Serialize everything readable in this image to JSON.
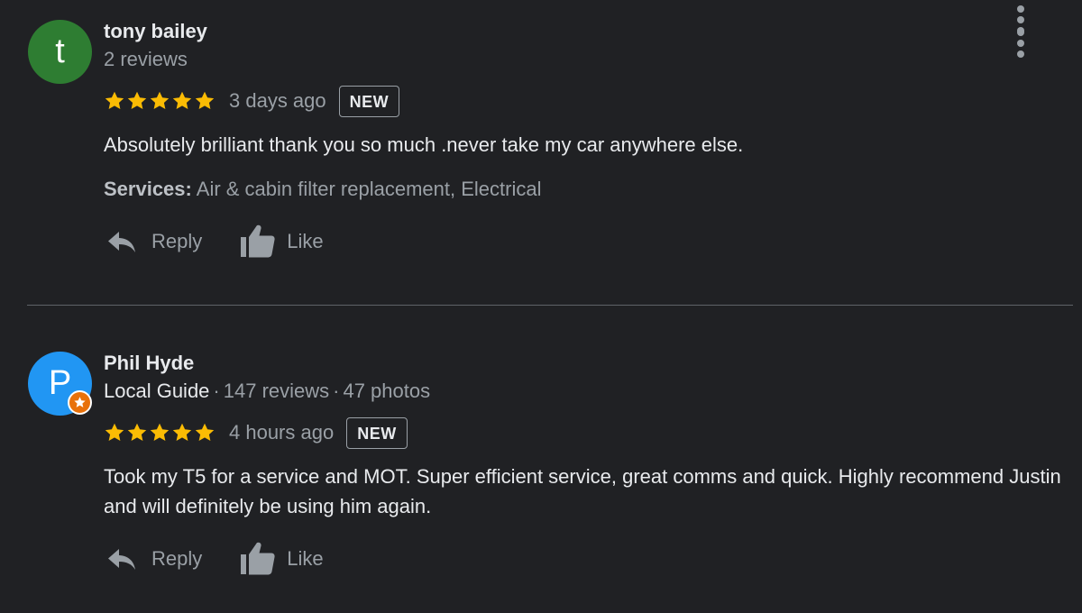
{
  "colors": {
    "background": "#202124",
    "star": "#fbbc04",
    "avatar_tony": "#2e7d32",
    "avatar_phil": "#2196f3",
    "local_guide_badge": "#e8710a",
    "muted_text": "#9aa0a6"
  },
  "reviews": [
    {
      "author": "tony bailey",
      "avatar_initial": "t",
      "meta": {
        "reviews_count": "2 reviews"
      },
      "rating": 5,
      "time": "3 days ago",
      "badge": "NEW",
      "text": "Absolutely brilliant thank you so much .never take my car anywhere else.",
      "services_label": "Services:",
      "services_value": "Air & cabin filter replacement, Electrical",
      "actions": {
        "reply": "Reply",
        "like": "Like"
      },
      "icons": [
        "reply-icon",
        "thumbs-up-icon",
        "more-vert-icon"
      ]
    },
    {
      "author": "Phil Hyde",
      "avatar_initial": "P",
      "meta": {
        "guide": "Local Guide",
        "separator": "·",
        "reviews_count": "147 reviews",
        "photos_count": "47 photos"
      },
      "rating": 5,
      "time": "4 hours ago",
      "badge": "NEW",
      "text": "Took my T5 for a service and MOT. Super efficient service, great comms and quick. Highly recommend Justin and will definitely be using him again.",
      "actions": {
        "reply": "Reply",
        "like": "Like"
      },
      "icons": [
        "local-guide-star-icon",
        "reply-icon",
        "thumbs-up-icon",
        "more-vert-icon"
      ]
    }
  ]
}
